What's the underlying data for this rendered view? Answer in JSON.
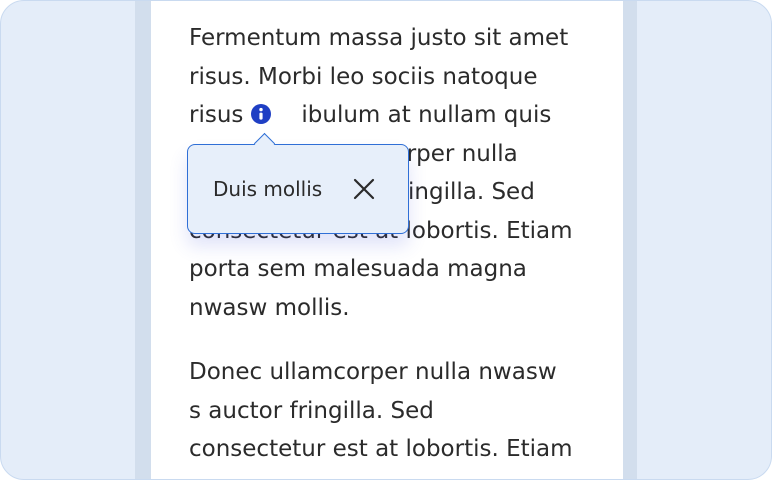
{
  "article": {
    "paragraph1": {
      "line1": "Fermentum massa justo sit amet",
      "line2": "risus. Morbi leo sociis natoque",
      "line3_before_icon": "risus",
      "line3_after_icon": "ibulum at nullam quis",
      "line4": "corper nulla",
      "line5": "ingilla.  Sed",
      "line6": "consectetur est at lobortis. Etiam",
      "line7": "porta sem malesuada magna",
      "line8": "nwasw mollis."
    },
    "paragraph2": {
      "line1": "Donec ullamcorper nulla nwasw",
      "line2": "s auctor fringilla.  Sed",
      "line3": "consectetur est at lobortis. Etiam"
    }
  },
  "popover": {
    "text": "Duis mollis",
    "close_icon": "close-icon"
  },
  "info_icon": "info-icon",
  "colors": {
    "frame_background": "#e4edf9",
    "gutter": "#d2deed",
    "accent": "#2f6fd6",
    "info_icon_fill": "#1f3fc4",
    "popover_background": "#e7effa"
  }
}
